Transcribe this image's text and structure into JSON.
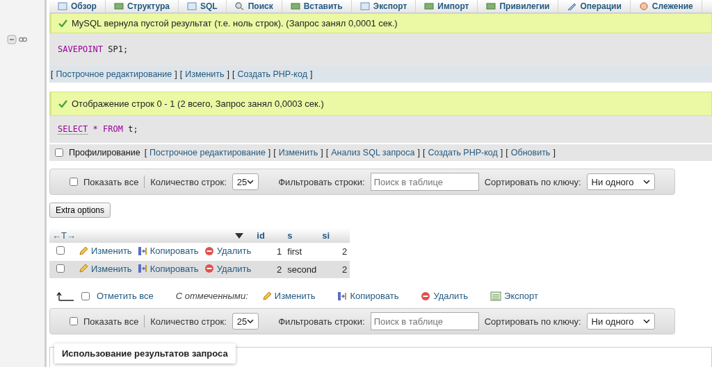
{
  "tabs": [
    {
      "label": "Обзор"
    },
    {
      "label": "Структура"
    },
    {
      "label": "SQL"
    },
    {
      "label": "Поиск"
    },
    {
      "label": "Вставить"
    },
    {
      "label": "Экспорт"
    },
    {
      "label": "Импорт"
    },
    {
      "label": "Привилегии"
    },
    {
      "label": "Операции"
    },
    {
      "label": "Слежение"
    }
  ],
  "queries": [
    {
      "message": "MySQL вернула пустой результат (т.е. ноль строк). (Запрос занял 0,0001 сек.)",
      "sql": [
        {
          "text": "SAVEPOINT",
          "kind": "keyword"
        },
        {
          "text": "SP1;",
          "kind": "plain"
        }
      ],
      "links": [
        {
          "open": "[",
          "label": "Построчное редактирование",
          "close": "]"
        },
        {
          "open": "[",
          "label": "Изменить",
          "close": "]"
        },
        {
          "open": "[",
          "label": "Создать PHP-код",
          "close": "]"
        }
      ]
    },
    {
      "message": "Отображение строк 0 - 1 (2 всего, Запрос занял 0,0003 сек.)",
      "sql": [
        {
          "text": "SELECT",
          "kind": "function"
        },
        {
          "text": "*",
          "kind": "keyword"
        },
        {
          "text": "FROM",
          "kind": "keyword"
        },
        {
          "text": "t;",
          "kind": "plain"
        }
      ],
      "profiling": {
        "label": "Профилирование",
        "checked": false
      },
      "links": [
        {
          "open": "[",
          "label": "Построчное редактирование",
          "close": "]"
        },
        {
          "open": "[",
          "label": "Изменить",
          "close": "]"
        },
        {
          "open": "[",
          "label": "Анализ SQL запроса",
          "close": "]"
        },
        {
          "open": "[",
          "label": "Создать PHP-код",
          "close": "]"
        },
        {
          "open": "[",
          "label": "Обновить",
          "close": "]"
        }
      ]
    }
  ],
  "nav_bars": [
    {
      "show_all": {
        "label": "Показать все",
        "checked": false
      },
      "rows_label": "Количество строк:",
      "rows_value": "25",
      "filter_label": "Фильтровать строки:",
      "filter_placeholder": "Поиск в таблице",
      "sort_label": "Сортировать по ключу:",
      "sort_value": "Ни одного"
    },
    {
      "show_all": {
        "label": "Показать все",
        "checked": false
      },
      "rows_label": "Количество строк:",
      "rows_value": "25",
      "filter_label": "Фильтровать строки:",
      "filter_placeholder": "Поиск в таблице",
      "sort_label": "Сортировать по ключу:",
      "sort_value": "Ни одного"
    }
  ],
  "extra_options": "Extra options",
  "table": {
    "resize_arrows": "←T→",
    "columns": [
      "id",
      "s",
      "si"
    ],
    "rows": [
      {
        "checked": false,
        "edit": "Изменить",
        "copy": "Копировать",
        "delete": "Удалить",
        "cells": [
          "1",
          "first",
          "2"
        ]
      },
      {
        "checked": false,
        "edit": "Изменить",
        "copy": "Копировать",
        "delete": "Удалить",
        "cells": [
          "2",
          "second",
          "2"
        ]
      }
    ]
  },
  "bulk": {
    "check_all": {
      "label": "Отметить все",
      "checked": false
    },
    "with_selected": "С отмеченными:",
    "edit": "Изменить",
    "copy": "Копировать",
    "delete": "Удалить",
    "export": "Экспорт"
  },
  "query_results_legend": "Использование результатов запроса"
}
